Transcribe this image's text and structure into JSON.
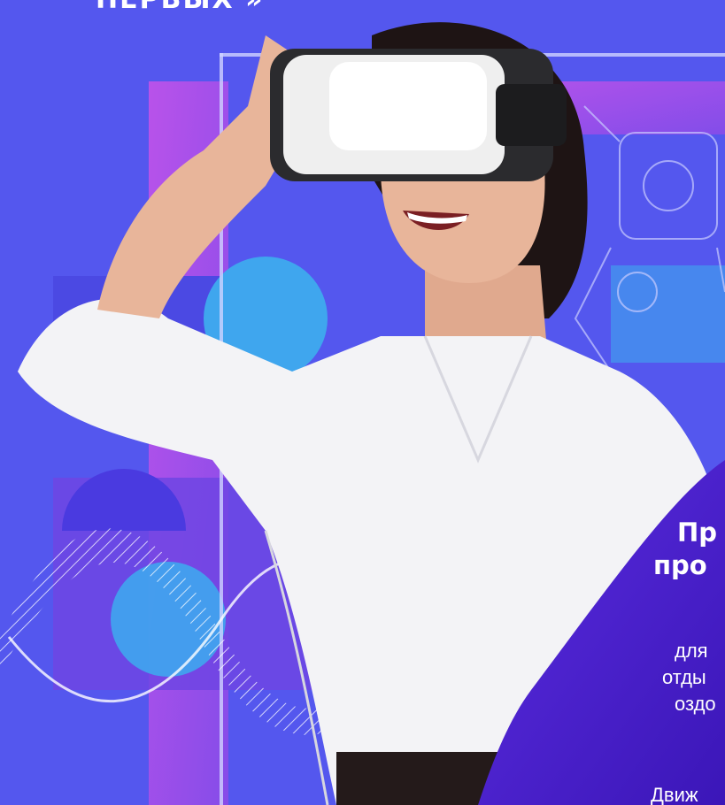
{
  "headline": {
    "text": "ПЕРВЫХ »"
  },
  "promo": {
    "title_lines": [
      "Пр",
      "про"
    ],
    "body_lines": [
      "для",
      "отды",
      "оздо"
    ],
    "footer_text": "Движ"
  },
  "colors": {
    "background": "#5457ee",
    "magenta": "#b54de6",
    "cyan": "#3fa6ee",
    "panel": "#4a21c9",
    "shirt": "#f3f3f6",
    "hair": "#1e1414",
    "skin": "#e8b59a"
  }
}
